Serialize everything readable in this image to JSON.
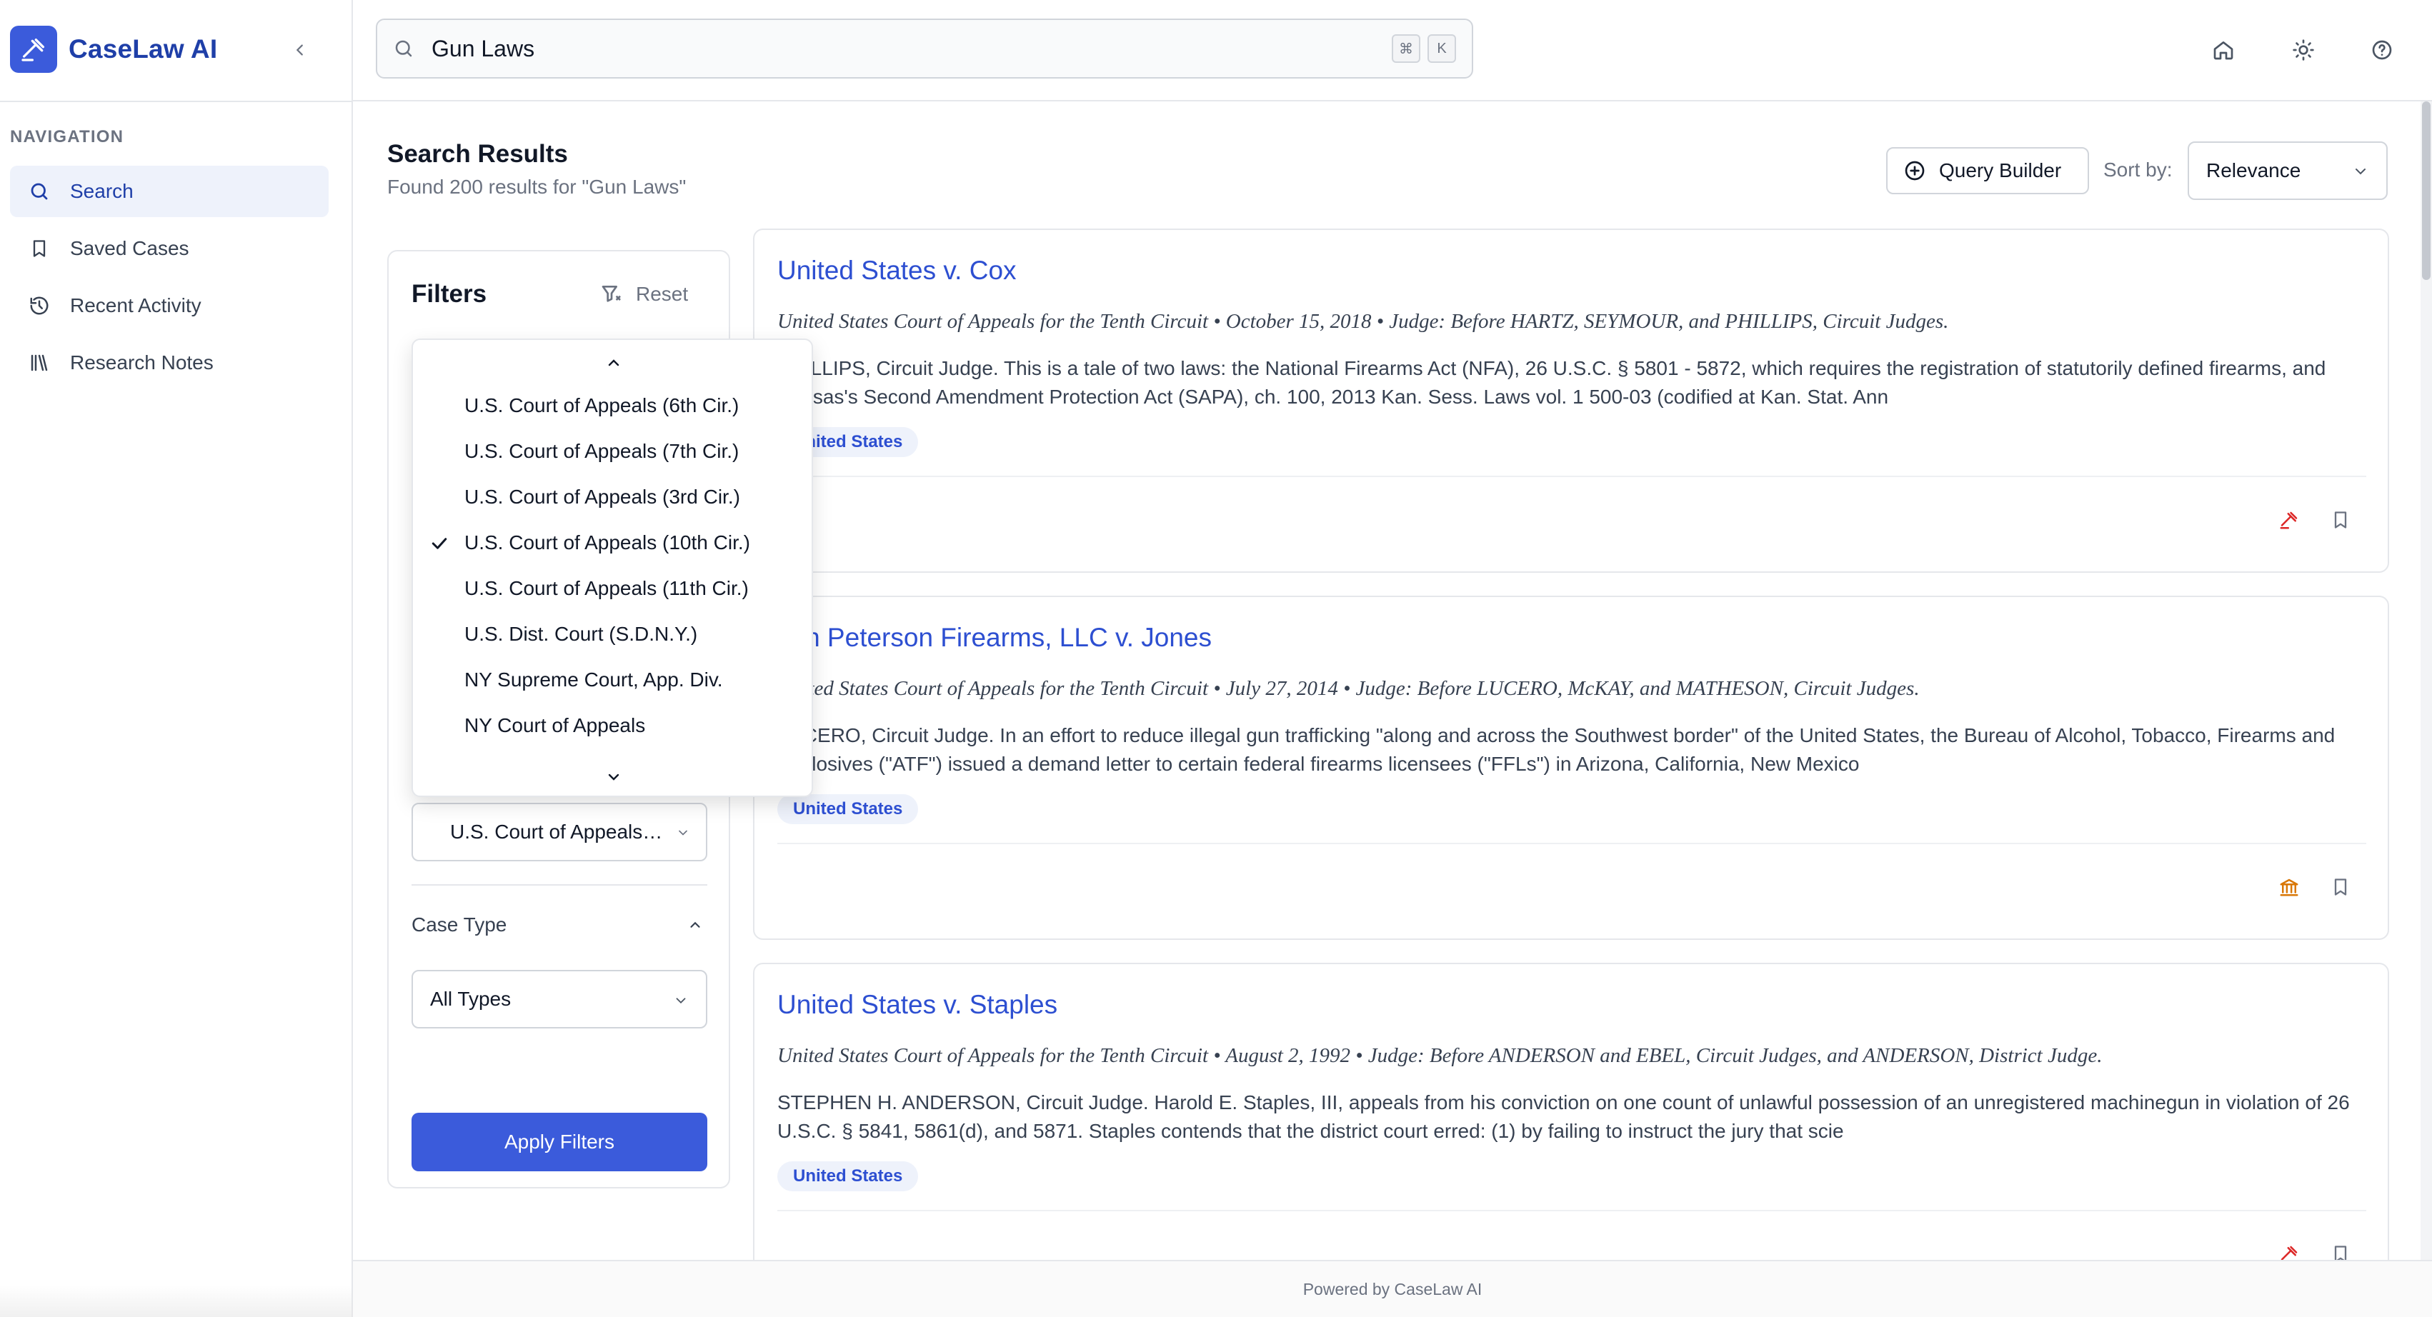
{
  "app": {
    "name": "CaseLaw AI"
  },
  "sidebar": {
    "nav_heading": "NAVIGATION",
    "items": [
      {
        "label": "Search",
        "icon": "search-icon",
        "active": true
      },
      {
        "label": "Saved Cases",
        "icon": "bookmark-icon",
        "active": false
      },
      {
        "label": "Recent Activity",
        "icon": "history-icon",
        "active": false
      },
      {
        "label": "Research Notes",
        "icon": "library-icon",
        "active": false
      }
    ]
  },
  "topbar": {
    "search_value": "Gun Laws",
    "shortcut_keys": [
      "⌘",
      "K"
    ],
    "icons": [
      "home-icon",
      "sun-icon",
      "help-icon"
    ]
  },
  "results": {
    "title": "Search Results",
    "subtitle": "Found 200 results for \"Gun Laws\"",
    "query_builder_label": "Query Builder",
    "sort_label": "Sort by:",
    "sort_value": "Relevance"
  },
  "filters": {
    "title": "Filters",
    "reset_label": "Reset",
    "court_selected": "U.S. Court of Appeals (10th Cir.)",
    "case_type_label": "Case Type",
    "case_type_value": "All Types",
    "apply_label": "Apply Filters",
    "court_options": [
      {
        "label": "U.S. Court of Appeals (6th Cir.)",
        "selected": false
      },
      {
        "label": "U.S. Court of Appeals (7th Cir.)",
        "selected": false
      },
      {
        "label": "U.S. Court of Appeals (3rd Cir.)",
        "selected": false
      },
      {
        "label": "U.S. Court of Appeals (10th Cir.)",
        "selected": true
      },
      {
        "label": "U.S. Court of Appeals (11th Cir.)",
        "selected": false
      },
      {
        "label": "U.S. Dist. Court (S.D.N.Y.)",
        "selected": false
      },
      {
        "label": "NY Supreme Court, App. Div.",
        "selected": false
      },
      {
        "label": "NY Court of Appeals",
        "selected": false
      }
    ]
  },
  "cases": [
    {
      "title": "United States v. Cox",
      "meta": "United States Court of Appeals for the Tenth Circuit • October 15, 2018 • Judge: Before HARTZ, SEYMOUR, and PHILLIPS, Circuit Judges.",
      "snippet": "PHILLIPS, Circuit Judge. This is a tale of two laws: the National Firearms Act (NFA), 26 U.S.C. § 5801 - 5872, which requires the registration of statutorily defined firearms, and Kansas's Second Amendment Protection Act (SAPA), ch. 100, 2013 Kan. Sess. Laws vol. 1 500-03 (codified at Kan. Stat. Ann",
      "tag": "United States",
      "action_icon": "gavel-icon",
      "action_color": "#dc2626"
    },
    {
      "title": "Jon Peterson Firearms, LLC v. Jones",
      "meta": "United States Court of Appeals for the Tenth Circuit • July 27, 2014 • Judge: Before LUCERO, McKAY, and MATHESON, Circuit Judges.",
      "snippet": "LUCERO, Circuit Judge. In an effort to reduce illegal gun trafficking \"along and across the Southwest border\" of the United States, the Bureau of Alcohol, Tobacco, Firearms and Explosives (\"ATF\") issued a demand letter to certain federal firearms licensees (\"FFLs\") in Arizona, California, New Mexico",
      "tag": "United States",
      "action_icon": "courthouse-icon",
      "action_color": "#d97706"
    },
    {
      "title": "United States v. Staples",
      "meta": "United States Court of Appeals for the Tenth Circuit • August 2, 1992 • Judge: Before ANDERSON and EBEL, Circuit Judges, and ANDERSON, District Judge.",
      "snippet": "STEPHEN H. ANDERSON, Circuit Judge. Harold E. Staples, III, appeals from his conviction on one count of unlawful possession of an unregistered machinegun in violation of 26 U.S.C. § 5841, 5861(d), and 5871. Staples contends that the district court erred: (1) by failing to instruct the jury that scie",
      "tag": "United States",
      "action_icon": "gavel-icon",
      "action_color": "#dc2626"
    }
  ],
  "footer": {
    "text": "Powered by CaseLaw AI"
  },
  "colors": {
    "accent": "#3b5bdb",
    "link": "#2d4fd1",
    "danger": "#dc2626",
    "warning": "#d97706"
  }
}
